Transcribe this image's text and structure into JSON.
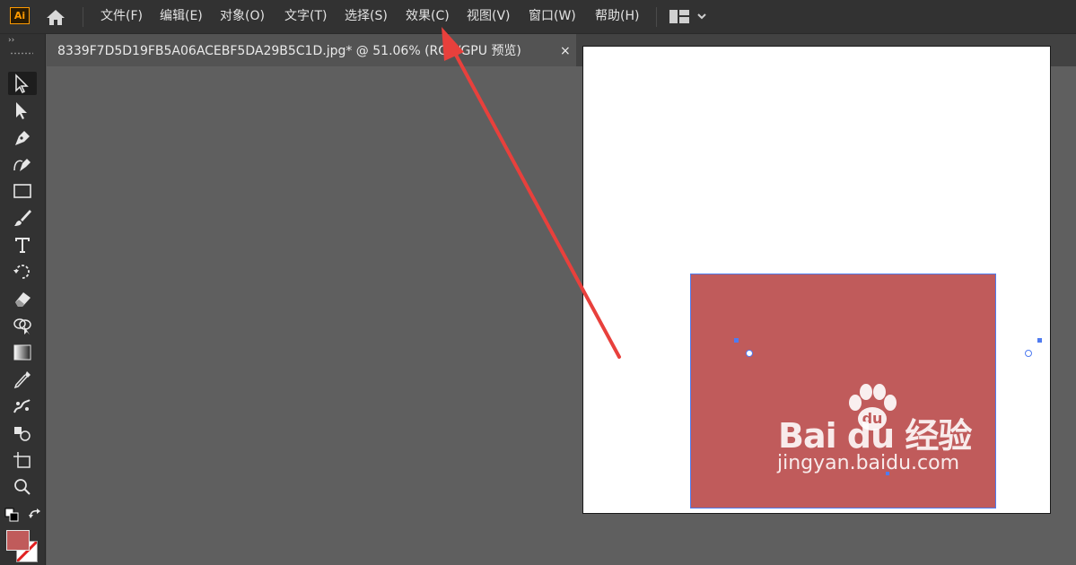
{
  "app": {
    "logo_text": "Ai",
    "accent": "#ff9a00"
  },
  "menu": {
    "items": [
      {
        "label": "文件(F)"
      },
      {
        "label": "编辑(E)"
      },
      {
        "label": "对象(O)"
      },
      {
        "label": "文字(T)"
      },
      {
        "label": "选择(S)"
      },
      {
        "label": "效果(C)"
      },
      {
        "label": "视图(V)"
      },
      {
        "label": "窗口(W)"
      },
      {
        "label": "帮助(H)"
      }
    ]
  },
  "document_tab": {
    "title": "8339F7D5D19FB5A06ACEBF5DA29B5C1D.jpg*  @  51.06%  (RGB/GPU 预览)",
    "close": "×"
  },
  "toolbar": {
    "collapse_glyph": "››",
    "tools": [
      {
        "name": "selection-tool-icon",
        "active": true
      },
      {
        "name": "direct-selection-tool-icon"
      },
      {
        "name": "pen-tool-icon"
      },
      {
        "name": "curvature-tool-icon"
      },
      {
        "name": "rectangle-tool-icon"
      },
      {
        "name": "paintbrush-tool-icon"
      },
      {
        "name": "type-tool-icon"
      },
      {
        "name": "rotate-tool-icon"
      },
      {
        "name": "eraser-tool-icon"
      },
      {
        "name": "shape-builder-tool-icon"
      },
      {
        "name": "gradient-tool-icon"
      },
      {
        "name": "eyedropper-tool-icon"
      },
      {
        "name": "puppet-warp-tool-icon"
      },
      {
        "name": "symbol-sprayer-tool-icon"
      },
      {
        "name": "artboard-tool-icon"
      },
      {
        "name": "zoom-tool-icon"
      }
    ],
    "fill_color": "#c05b5b"
  },
  "canvas": {
    "shape_fill": "#c05b5b",
    "selection_color": "#4f7bf0"
  },
  "watermark": {
    "brand": "Bai du 经验",
    "url": "jingyan.baidu.com"
  },
  "annotation": {
    "arrow_color": "#e8403c"
  }
}
